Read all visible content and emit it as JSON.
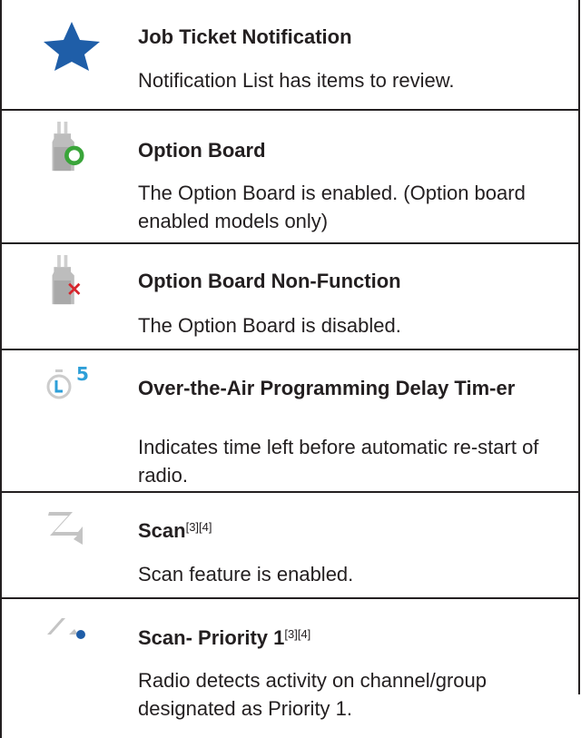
{
  "rows": [
    {
      "icon": "star-icon",
      "title": "Job Ticket Notification",
      "desc": "Notification List has items to review."
    },
    {
      "icon": "option-board-icon",
      "title": "Option Board",
      "desc": "The Option Board is enabled. (Option board enabled models only)"
    },
    {
      "icon": "option-board-disabled-icon",
      "title": "Option Board Non-Function",
      "desc": "The Option Board is disabled."
    },
    {
      "icon": "ota-delay-timer-icon",
      "title": "Over-the-Air Programming Delay Tim-er",
      "desc": "Indicates time left before automatic re-start of radio.",
      "icon_text": "5"
    },
    {
      "icon": "scan-icon",
      "title": "Scan",
      "sup": "[3][4]",
      "desc": "Scan feature is enabled."
    },
    {
      "icon": "scan-priority-1-icon",
      "title": "Scan- Priority 1",
      "sup": "[3][4]",
      "desc": "Radio detects activity on channel/group designated as Priority 1."
    }
  ],
  "colors": {
    "star": "#1f5ea8",
    "ring_green": "#3aa53a",
    "red_x": "#d6262d",
    "timer_blue": "#2e9fd8",
    "scan_gray": "#bfbfbf",
    "dot_blue": "#1f5ea8",
    "rule": "#231f20"
  }
}
